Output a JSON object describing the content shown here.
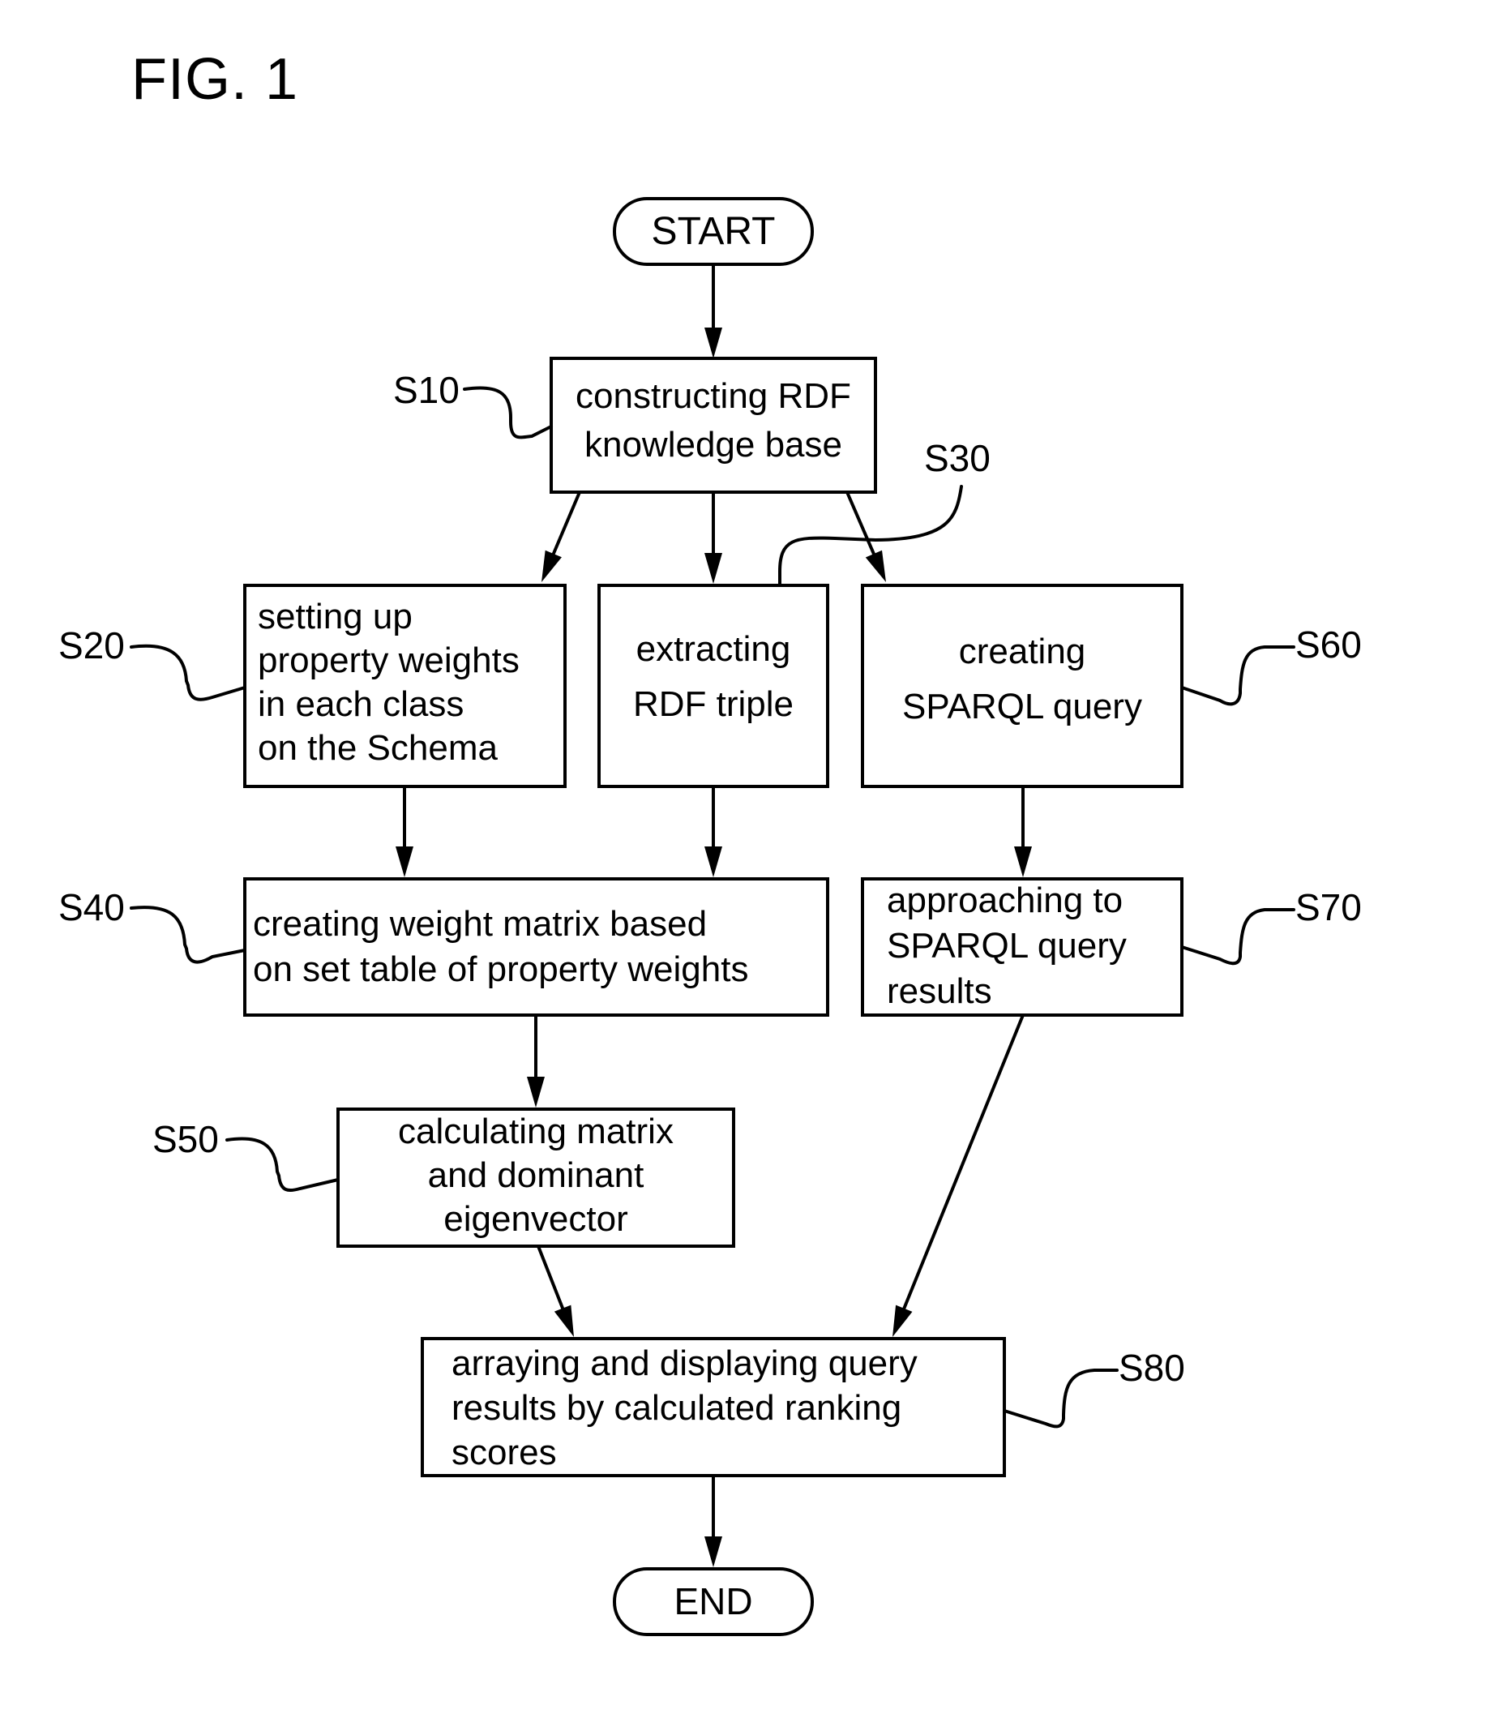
{
  "figure": {
    "title": "FIG. 1"
  },
  "terminals": {
    "start": "START",
    "end": "END"
  },
  "steps": [
    {
      "id": "S10",
      "ref": "S10",
      "lines": [
        "constructing RDF",
        "knowledge base"
      ],
      "align": "center"
    },
    {
      "id": "S20",
      "ref": "S20",
      "lines": [
        "setting up",
        "property weights",
        "in each class",
        "on the Schema"
      ],
      "align": "left"
    },
    {
      "id": "S30",
      "ref": "S30",
      "lines": [
        "extracting",
        "RDF triple"
      ],
      "align": "center"
    },
    {
      "id": "S40",
      "ref": "S40",
      "lines": [
        "creating weight matrix based",
        "on set table of property weights"
      ],
      "align": "left"
    },
    {
      "id": "S50",
      "ref": "S50",
      "lines": [
        "calculating matrix",
        "and dominant",
        "eigenvector"
      ],
      "align": "center"
    },
    {
      "id": "S60",
      "ref": "S60",
      "lines": [
        "creating",
        "SPARQL query"
      ],
      "align": "center"
    },
    {
      "id": "S70",
      "ref": "S70",
      "lines": [
        "approaching to",
        "SPARQL query",
        "results"
      ],
      "align": "left"
    },
    {
      "id": "S80",
      "ref": "S80",
      "lines": [
        "arraying and displaying query",
        "results by calculated ranking",
        "scores"
      ],
      "align": "left"
    }
  ],
  "edges": [
    {
      "from": "START",
      "to": "S10"
    },
    {
      "from": "S10",
      "to": "S20"
    },
    {
      "from": "S10",
      "to": "S30"
    },
    {
      "from": "S10",
      "to": "S60"
    },
    {
      "from": "S20",
      "to": "S40"
    },
    {
      "from": "S30",
      "to": "S40"
    },
    {
      "from": "S60",
      "to": "S70"
    },
    {
      "from": "S40",
      "to": "S50"
    },
    {
      "from": "S50",
      "to": "S80"
    },
    {
      "from": "S70",
      "to": "S80"
    },
    {
      "from": "S80",
      "to": "END"
    }
  ]
}
